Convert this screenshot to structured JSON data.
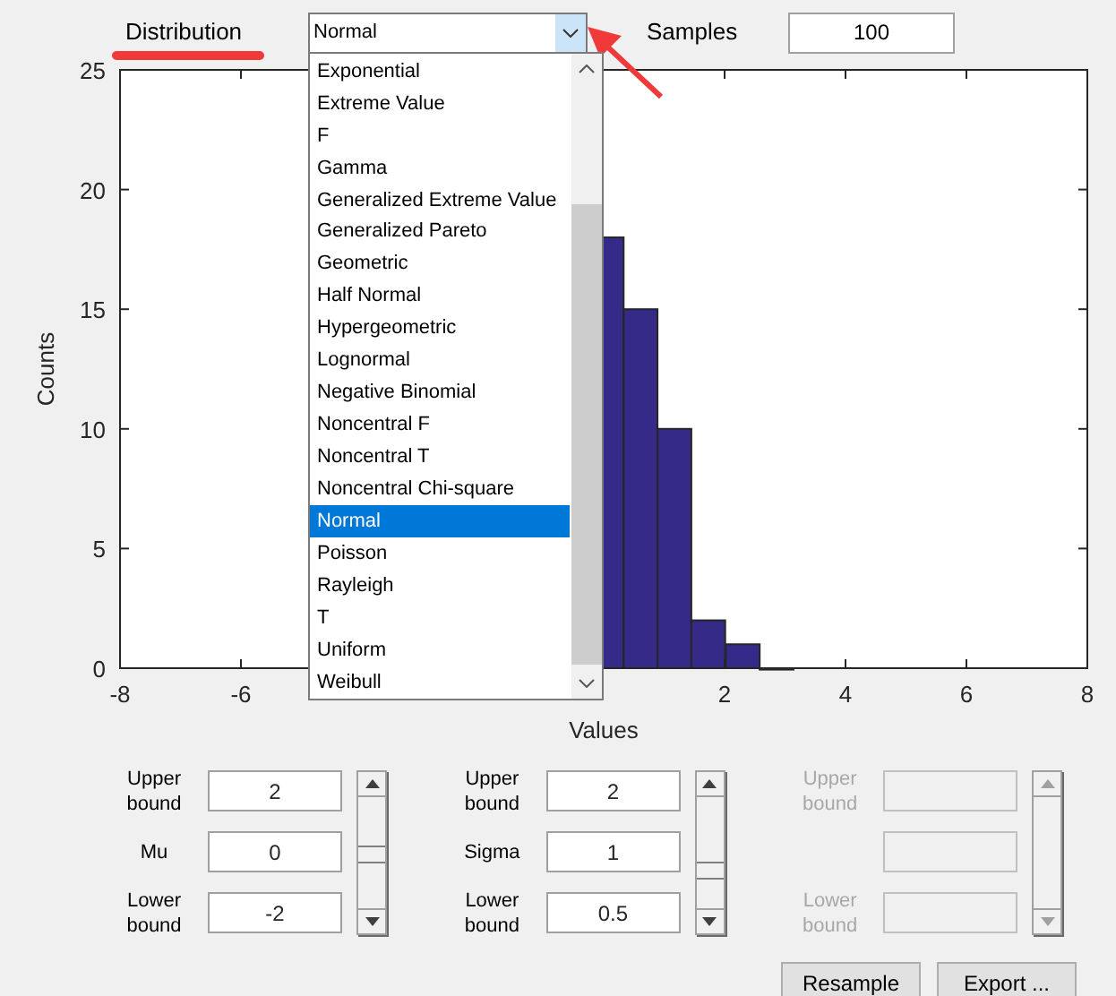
{
  "distribution": {
    "label": "Distribution",
    "value": "Normal",
    "expanded": true,
    "options": [
      {
        "label": "Exponential",
        "selected": false
      },
      {
        "label": "Extreme Value",
        "selected": false
      },
      {
        "label": "F",
        "selected": false
      },
      {
        "label": "Gamma",
        "selected": false
      },
      {
        "label": "Generalized Extreme Value",
        "selected": false
      },
      {
        "label": "Generalized Pareto",
        "selected": false
      },
      {
        "label": "Geometric",
        "selected": false
      },
      {
        "label": "Half Normal",
        "selected": false
      },
      {
        "label": "Hypergeometric",
        "selected": false
      },
      {
        "label": "Lognormal",
        "selected": false
      },
      {
        "label": "Negative Binomial",
        "selected": false
      },
      {
        "label": "Noncentral F",
        "selected": false
      },
      {
        "label": "Noncentral T",
        "selected": false
      },
      {
        "label": "Noncentral Chi-square",
        "selected": false
      },
      {
        "label": "Normal",
        "selected": true
      },
      {
        "label": "Poisson",
        "selected": false
      },
      {
        "label": "Rayleigh",
        "selected": false
      },
      {
        "label": "T",
        "selected": false
      },
      {
        "label": "Uniform",
        "selected": false
      },
      {
        "label": "Weibull",
        "selected": false
      }
    ]
  },
  "samples": {
    "label": "Samples",
    "value": "100"
  },
  "chart_data": {
    "type": "bar",
    "xlabel": "Values",
    "ylabel": "Counts",
    "x": [
      0.05,
      0.61,
      1.17,
      1.73,
      2.3,
      2.86
    ],
    "values": [
      18,
      15,
      10,
      2,
      1,
      0
    ],
    "xlim": [
      -8,
      8
    ],
    "ylim": [
      0,
      25
    ],
    "xticks": [
      -8,
      -6,
      2,
      4,
      6,
      8
    ],
    "yticks": [
      0,
      5,
      10,
      15,
      20,
      25
    ]
  },
  "parameter_groups": [
    {
      "disabled": false,
      "slider": {
        "level": 0.5
      },
      "fields": [
        {
          "label": "Upper bound",
          "value": "2"
        },
        {
          "label": "Mu",
          "value": "0"
        },
        {
          "label": "Lower bound",
          "value": "-2"
        }
      ]
    },
    {
      "disabled": false,
      "slider": {
        "level": 0.33
      },
      "fields": [
        {
          "label": "Upper bound",
          "value": "2"
        },
        {
          "label": "Sigma",
          "value": "1"
        },
        {
          "label": "Lower bound",
          "value": "0.5"
        }
      ]
    },
    {
      "disabled": true,
      "fields": [
        {
          "label": "Upper bound"
        },
        {
          "label": "Lower bound"
        }
      ]
    }
  ],
  "buttons": [
    "Resample",
    "Export ..."
  ]
}
